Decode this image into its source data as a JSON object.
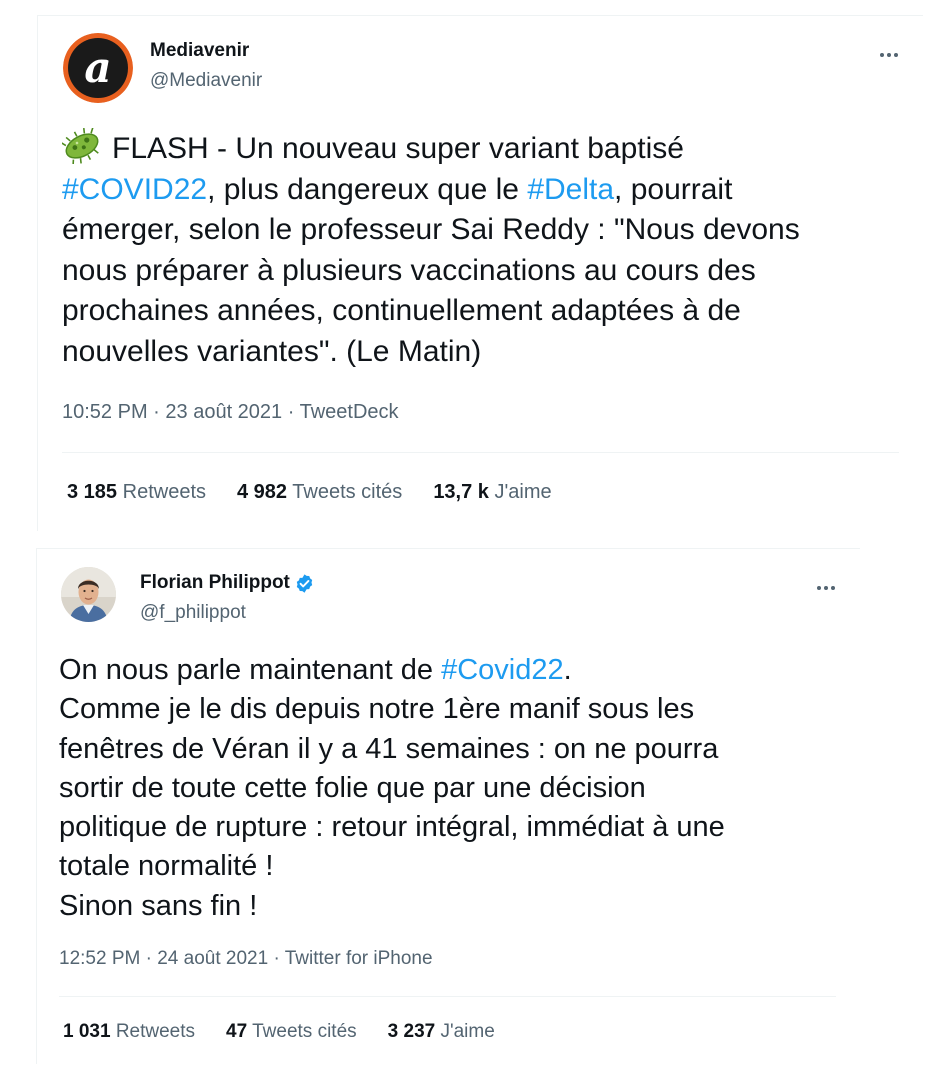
{
  "tweets": [
    {
      "author": {
        "name": "Mediavenir",
        "handle": "@Mediavenir",
        "verified": false,
        "avatar_letter": "a"
      },
      "text": {
        "emoji": "microbe-icon",
        "lines": [
          [
            {
              "t": "FLASH - Un nouveau super variant baptisé"
            }
          ],
          [
            {
              "t": "#COVID22",
              "tag": true
            },
            {
              "t": ", plus dangereux que le "
            },
            {
              "t": "#Delta",
              "tag": true
            },
            {
              "t": ", pourrait"
            }
          ],
          [
            {
              "t": "émerger, selon le professeur Sai Reddy : \"Nous devons"
            }
          ],
          [
            {
              "t": "nous préparer à plusieurs vaccinations au cours des"
            }
          ],
          [
            {
              "t": "prochaines années, continuellement adaptées à de"
            }
          ],
          [
            {
              "t": "nouvelles variantes\". (Le Matin)"
            }
          ]
        ]
      },
      "time": "10:52 PM",
      "date": "23 août 2021",
      "source": "TweetDeck",
      "stats": [
        {
          "value": "3 185",
          "label": "Retweets"
        },
        {
          "value": "4 982",
          "label": "Tweets cités"
        },
        {
          "value": "13,7 k",
          "label": "J'aime"
        }
      ]
    },
    {
      "author": {
        "name": "Florian Philippot",
        "handle": "@f_philippot",
        "verified": true
      },
      "text": {
        "lines": [
          [
            {
              "t": "On nous parle maintenant de "
            },
            {
              "t": "#Covid22",
              "tag": true
            },
            {
              "t": "."
            }
          ],
          [
            {
              "t": "Comme je le dis depuis notre 1ère manif sous les"
            }
          ],
          [
            {
              "t": "fenêtres de Véran il y a 41 semaines : on ne pourra"
            }
          ],
          [
            {
              "t": "sortir de toute cette folie que par une décision"
            }
          ],
          [
            {
              "t": "politique de rupture : retour intégral, immédiat à une"
            }
          ],
          [
            {
              "t": "totale normalité !"
            }
          ],
          [
            {
              "t": "Sinon sans fin !"
            }
          ]
        ]
      },
      "time": "12:52 PM",
      "date": "24 août 2021",
      "source": "Twitter for iPhone",
      "stats": [
        {
          "value": "1 031",
          "label": "Retweets"
        },
        {
          "value": "47",
          "label": "Tweets cités"
        },
        {
          "value": "3 237",
          "label": "J'aime"
        }
      ]
    }
  ],
  "meta_separator": " · ",
  "colors": {
    "link": "#1d9bf0",
    "secondary": "#536471",
    "text": "#0f1419",
    "verified": "#1d9bf0"
  }
}
